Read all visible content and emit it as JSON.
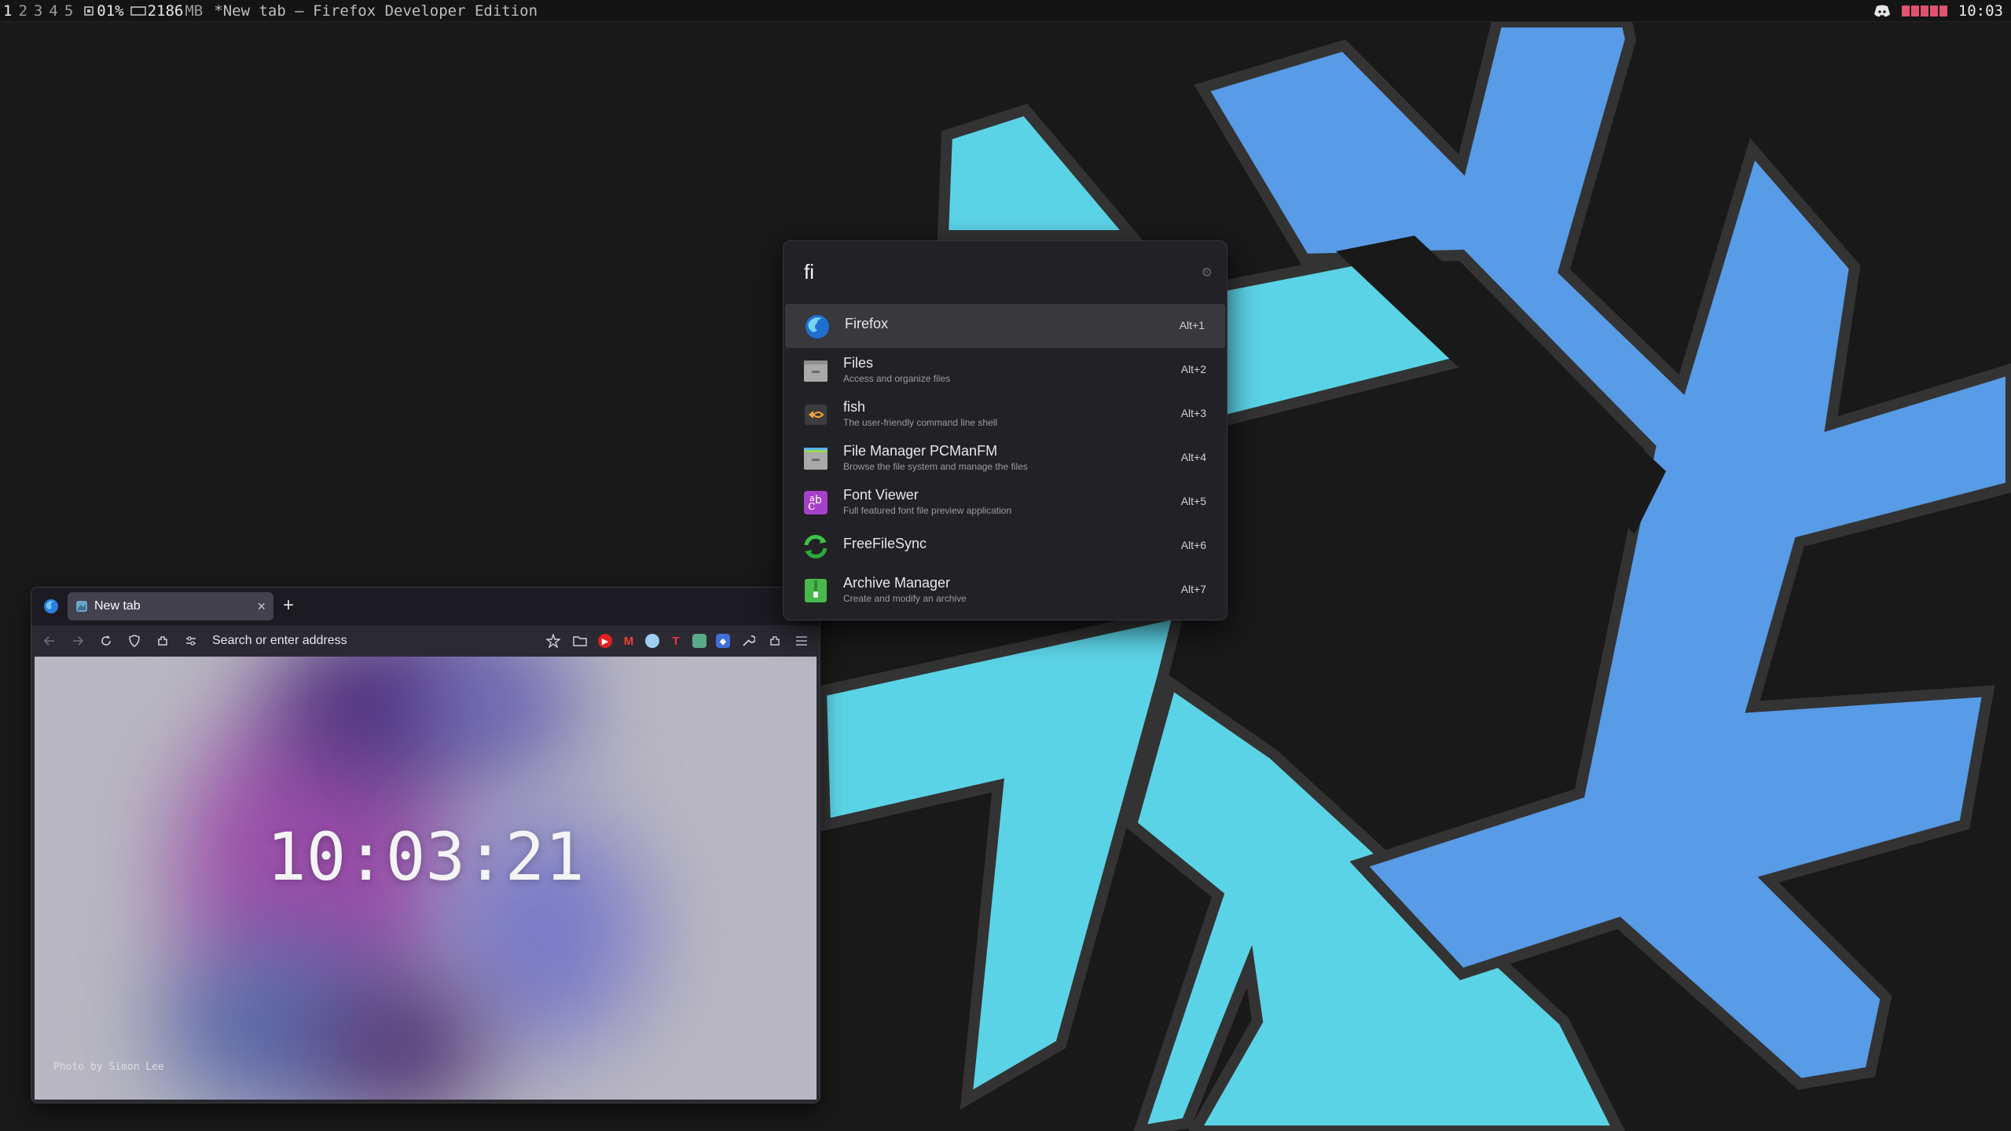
{
  "topbar": {
    "workspaces": [
      "1",
      "2",
      "3",
      "4",
      "5"
    ],
    "cpu": "01%",
    "mem": "2186",
    "mem_unit": "MB",
    "window_title": "*New tab — Firefox Developer Edition",
    "clock": "10:03",
    "colors": {
      "battery": "#e0526f"
    }
  },
  "firefox": {
    "tab_title": "New tab",
    "tab_close": "×",
    "new_tab": "+",
    "url_placeholder": "Search or enter address",
    "clock": "10:03:21",
    "photo_credit": "Photo by Simon Lee"
  },
  "launcher": {
    "query": "fi",
    "results": [
      {
        "name": "Firefox",
        "desc": "",
        "shortcut": "Alt+1",
        "icon": "firefox-icon"
      },
      {
        "name": "Files",
        "desc": "Access and organize files",
        "shortcut": "Alt+2",
        "icon": "files-icon"
      },
      {
        "name": "fish",
        "desc": "The user-friendly command line shell",
        "shortcut": "Alt+3",
        "icon": "fish-icon"
      },
      {
        "name": "File Manager PCManFM",
        "desc": "Browse the file system and manage the files",
        "shortcut": "Alt+4",
        "icon": "pcmanfm-icon"
      },
      {
        "name": "Font Viewer",
        "desc": "Full featured font file preview application",
        "shortcut": "Alt+5",
        "icon": "font-viewer-icon"
      },
      {
        "name": "FreeFileSync",
        "desc": "",
        "shortcut": "Alt+6",
        "icon": "freefilesync-icon"
      },
      {
        "name": "Archive Manager",
        "desc": "Create and modify an archive",
        "shortcut": "Alt+7",
        "icon": "archive-manager-icon"
      }
    ]
  },
  "wallpaper": {
    "colors": {
      "background": "#191919",
      "outline": "#333333",
      "cyan": "#5bd3e6",
      "blue": "#589be6"
    }
  }
}
